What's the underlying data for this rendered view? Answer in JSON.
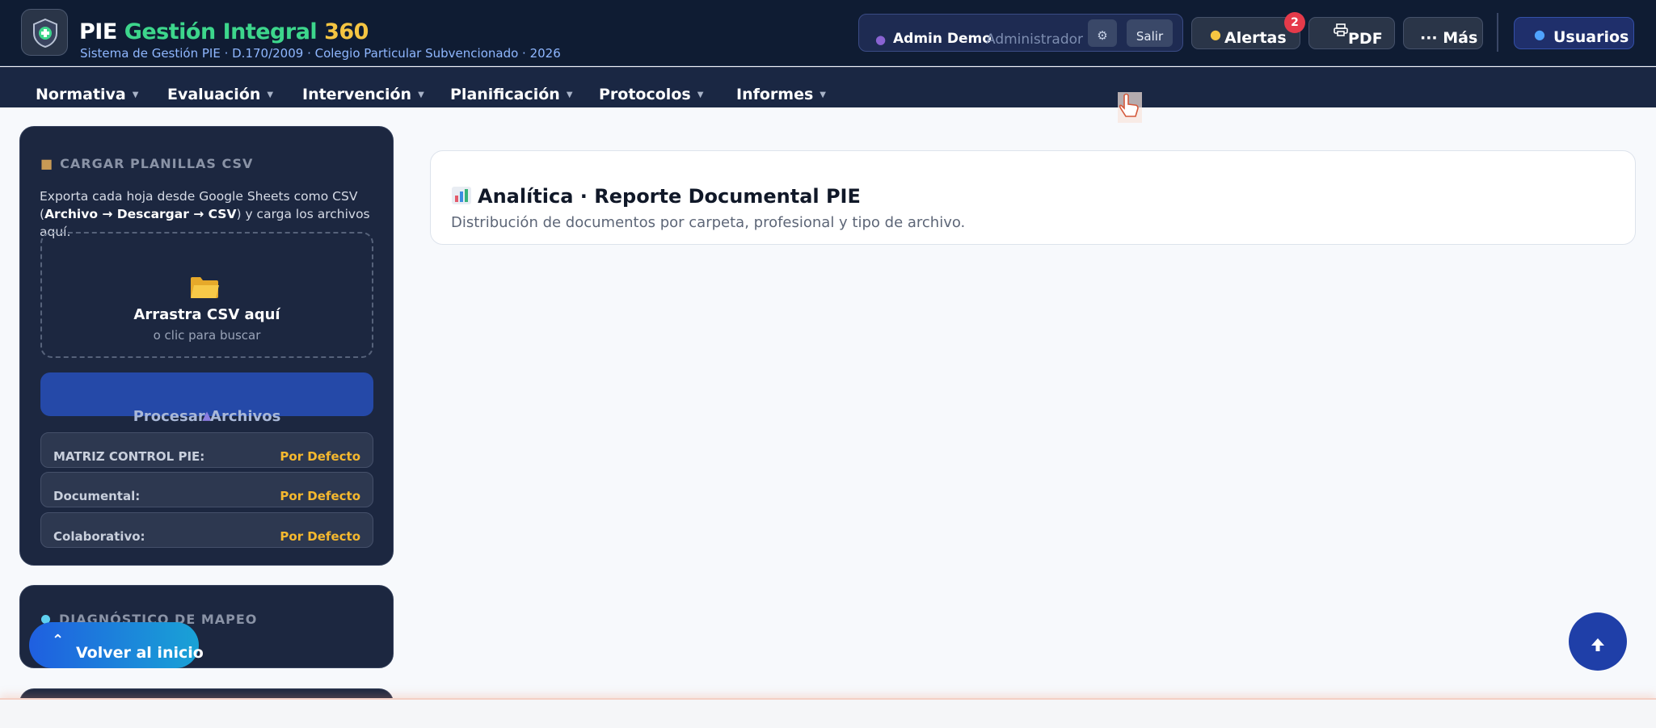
{
  "header": {
    "brand_part1": "PIE",
    "brand_part2": "Gestión Integral",
    "brand_part3": "360",
    "subtitle": "Sistema de Gestión PIE · D.170/2009 · Colegio Particular Subvencionado · 2026",
    "user": {
      "name": "Admin Demo",
      "role": "Administrador",
      "settings_icon": "gear-icon",
      "logout_label": "Salir"
    },
    "alerts_label": "Alertas",
    "alerts_count": "2",
    "pdf_label": "PDF",
    "more_label": "··· Más",
    "users_label": "Usuarios"
  },
  "nav": {
    "items": [
      "Normativa",
      "Evaluación",
      "Intervención",
      "Planificación",
      "Protocolos",
      "Informes"
    ]
  },
  "sidebar": {
    "upload_title": "CARGAR PLANILLAS CSV",
    "desc_start": "Exporta cada hoja desde Google Sheets como CSV (",
    "desc_path": "Archivo → Descargar → CSV",
    "desc_end": ") y carga los archivos aquí.",
    "drop_title": "Arrastra CSV aquí",
    "drop_sub": "o clic para buscar",
    "process_label": "Procesar Archivos",
    "statuses": [
      {
        "label": "MATRIZ CONTROL PIE:",
        "value": "Por Defecto"
      },
      {
        "label": "Documental:",
        "value": "Por Defecto"
      },
      {
        "label": "Colaborativo:",
        "value": "Por Defecto"
      }
    ],
    "diagnostic_title": "DIAGNÓSTICO DE MAPEO",
    "back_label": "Volver al inicio"
  },
  "main": {
    "title": "Analítica · Reporte Documental PIE",
    "subtitle": "Distribución de documentos por carpeta, profesional y tipo de archivo."
  },
  "colors": {
    "header_bg": "#0f1c33",
    "accent_green": "#3dd68c",
    "accent_yellow": "#f5c542",
    "status_value": "#f5b82e",
    "primary_blue": "#2549a8"
  }
}
